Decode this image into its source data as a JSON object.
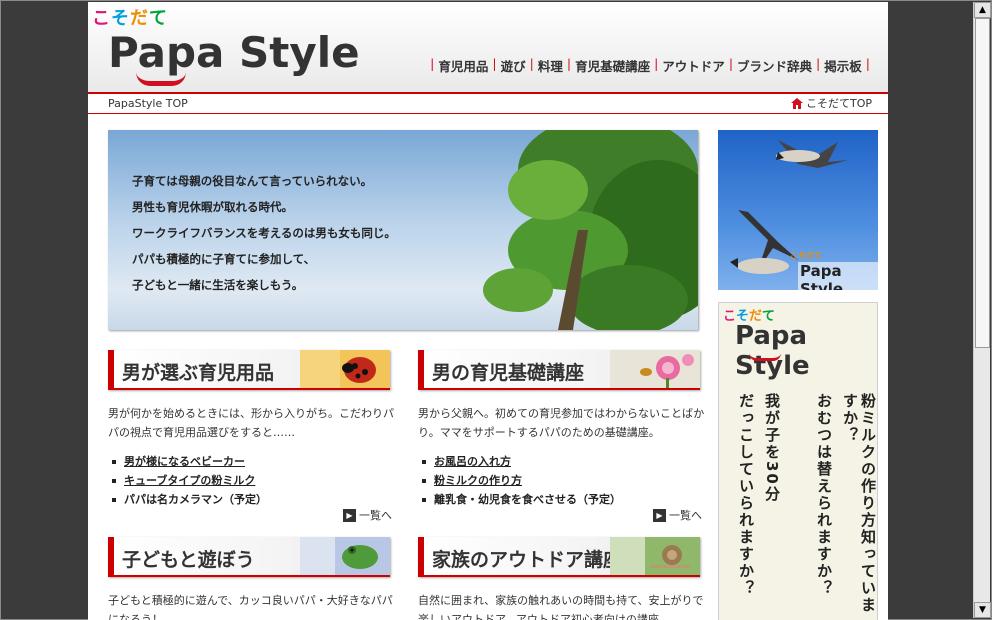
{
  "header": {
    "kosodate_chars": [
      "こ",
      "そ",
      "だ",
      "て"
    ],
    "logo_text": "Papa Style",
    "nav": [
      "育児用品",
      "遊び",
      "料理",
      "育児基礎講座",
      "アウトドア",
      "ブランド辞典",
      "掲示板"
    ]
  },
  "breadcrumb": {
    "current": "PapaStyle TOP",
    "home_link": "こそだてTOP"
  },
  "hero": {
    "lines": [
      "子育ては母親の役目なんて言っていられない。",
      "男性も育児休暇が取れる時代。",
      "ワークライフバランスを考えるのは男も女も同じ。",
      "パパも積極的に子育てに参加して、",
      "子どもと一緒に生活を楽しもう。"
    ]
  },
  "sections": {
    "goods": {
      "title": "男が選ぶ育児用品",
      "desc": "男が何かを始めるときには、形から入りがち。こだわりパパの視点で育児用品選びをすると……",
      "items": [
        "男が様になるベビーカー",
        "キューブタイプの粉ミルク",
        "パパは名カメラマン（予定）"
      ],
      "more": "一覧へ"
    },
    "basics": {
      "title": "男の育児基礎講座",
      "desc": "男から父親へ。初めての育児参加ではわからないことばかり。ママをサポートするパパのための基礎講座。",
      "items": [
        "お風呂の入れ方",
        "粉ミルクの作り方",
        "離乳食・幼児食を食べさせる（予定）"
      ],
      "more": "一覧へ"
    },
    "play": {
      "title": "子どもと遊ぼう",
      "desc": "子どもと積極的に遊んで、カッコ良いパパ・大好きなパパになろう！"
    },
    "outdoor": {
      "title": "家族のアウトドア講座",
      "desc": "自然に囲まれ、家族の触れあいの時間も持て、安上がりで楽しいアウトドア。アウトドア初心者向けの講座。"
    }
  },
  "side": {
    "banner1_logo": "Papa Style",
    "banner1_kosodate": "こそだて",
    "banner2_kosodate_chars": [
      "こ",
      "そ",
      "だ",
      "て"
    ],
    "banner2_logo": "Papa Style",
    "banner2_columns": [
      "粉ミルクの作り方知っていますか？",
      "おむつは替えられますか？",
      "我が子を30分",
      "だっこしていられますか？"
    ]
  },
  "scrollbar": {
    "up": "▲",
    "down": "▼"
  }
}
